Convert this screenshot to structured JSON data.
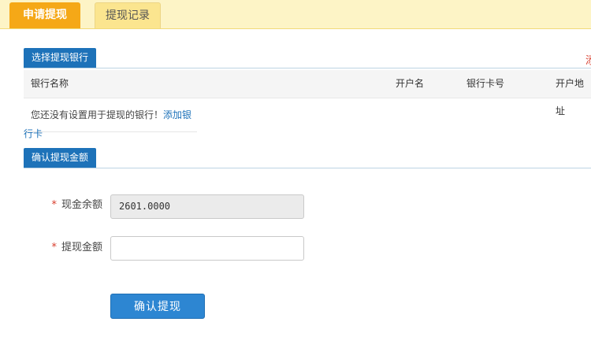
{
  "tabs": [
    {
      "label": "申请提现",
      "active": true
    },
    {
      "label": "提现记录",
      "active": false
    }
  ],
  "bank_section": {
    "title": "选择提现银行",
    "corner_char": "添",
    "columns": [
      "银行名称",
      "开户名",
      "银行卡号",
      "开户地址"
    ],
    "empty_text": "您还没有设置用于提现的银行！",
    "add_link": "添加银行卡"
  },
  "amount_section": {
    "title": "确认提现金额",
    "balance_label": "现金余额",
    "balance_value": "2601.0000",
    "amount_label": "提现金额",
    "amount_value": "",
    "required_mark": "*",
    "submit_label": "确认提现"
  },
  "colors": {
    "tab_active": "#f5a817",
    "section_blue": "#1d72b9",
    "button_blue": "#2d86d2",
    "required_red": "#d83c2b"
  }
}
